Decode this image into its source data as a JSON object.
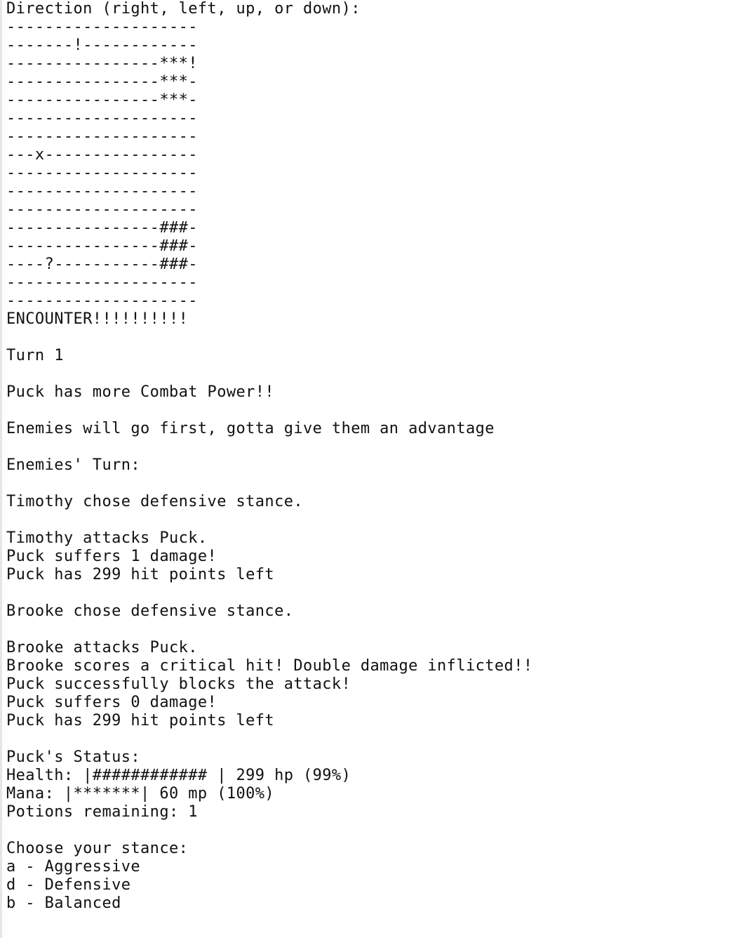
{
  "terminal": {
    "lines": [
      "Direction (right, left, up, or down):",
      "--------------------",
      "-------!------------",
      "----------------***!",
      "----------------***-",
      "----------------***-",
      "--------------------",
      "--------------------",
      "---x----------------",
      "--------------------",
      "--------------------",
      "--------------------",
      "----------------###-",
      "----------------###-",
      "----?-----------###-",
      "--------------------",
      "--------------------",
      "ENCOUNTER!!!!!!!!!!",
      "",
      "Turn 1",
      "",
      "Puck has more Combat Power!!",
      "",
      "Enemies will go first, gotta give them an advantage",
      "",
      "Enemies' Turn:",
      "",
      "Timothy chose defensive stance.",
      "",
      "Timothy attacks Puck.",
      "Puck suffers 1 damage!",
      "Puck has 299 hit points left",
      "",
      "Brooke chose defensive stance.",
      "",
      "Brooke attacks Puck.",
      "Brooke scores a critical hit! Double damage inflicted!!",
      "Puck successfully blocks the attack!",
      "Puck suffers 0 damage!",
      "Puck has 299 hit points left",
      "",
      "Puck's Status:",
      "Health: |############ | 299 hp (99%)",
      "Mana: |*******| 60 mp (100%)",
      "Potions remaining: 1",
      "",
      "Choose your stance:",
      "a - Aggressive",
      "d - Defensive",
      "b - Balanced"
    ],
    "top_partial": "--------------------"
  }
}
